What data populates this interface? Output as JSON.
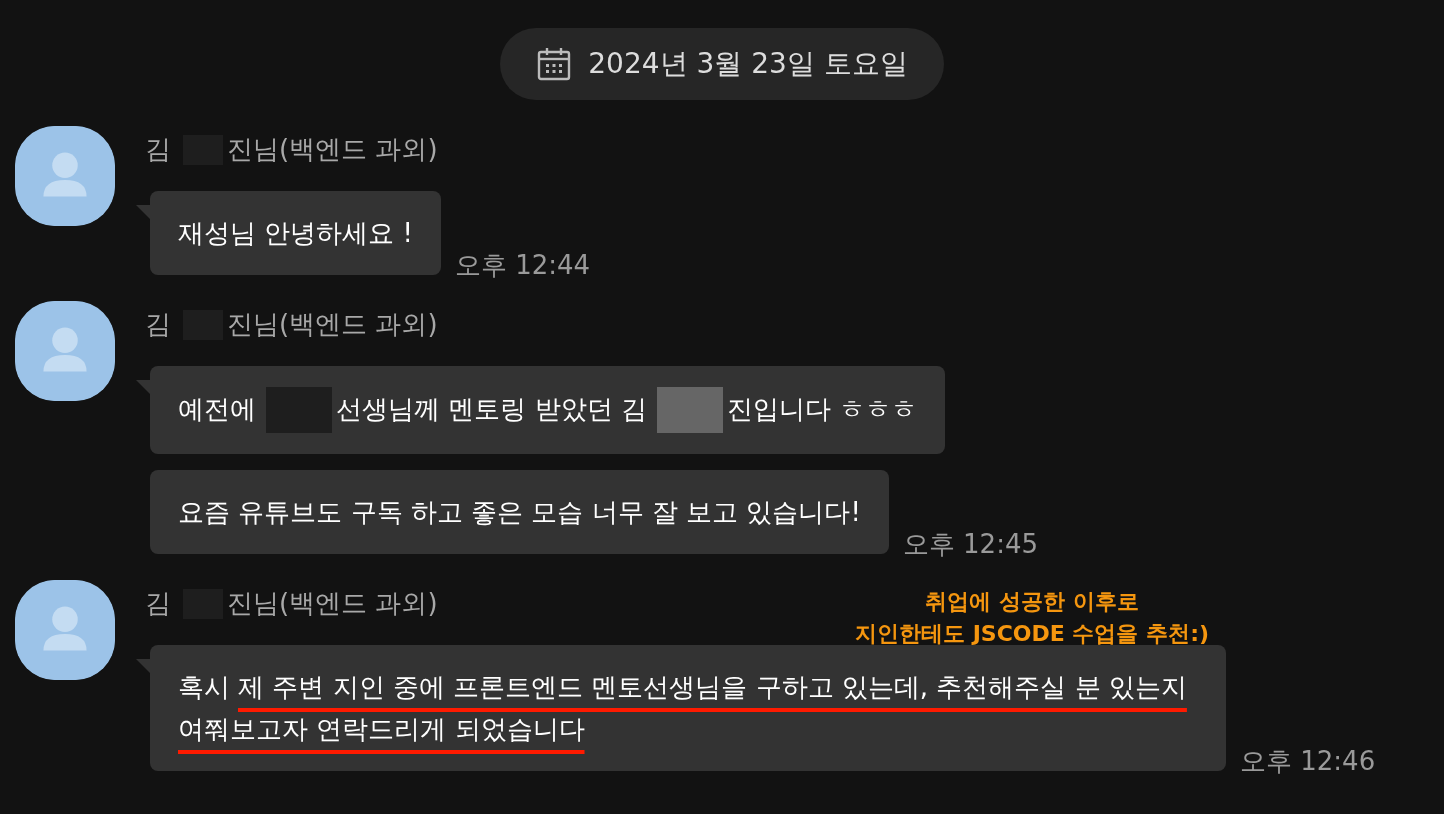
{
  "date_divider": {
    "text": "2024년 3월 23일 토요일"
  },
  "groups": [
    {
      "sender": [
        {
          "kind": "text",
          "text": "김"
        },
        {
          "kind": "redacted",
          "color": "#1e1e1e"
        },
        {
          "kind": "text",
          "text": "진님(백엔드 과외)"
        }
      ],
      "messages": [
        {
          "parts": [
            {
              "kind": "text",
              "text": "재성님 안녕하세요 !"
            }
          ]
        }
      ],
      "time": "오후 12:44"
    },
    {
      "sender": [
        {
          "kind": "text",
          "text": "김"
        },
        {
          "kind": "redacted",
          "color": "#1e1e1e"
        },
        {
          "kind": "text",
          "text": "진님(백엔드 과외)"
        }
      ],
      "messages": [
        {
          "parts": [
            {
              "kind": "text",
              "text": "예전에"
            },
            {
              "kind": "redacted",
              "color": "#1e1e1e"
            },
            {
              "kind": "text",
              "text": "선생님께 멘토링 받았던 김"
            },
            {
              "kind": "redacted",
              "color": "#666666"
            },
            {
              "kind": "text",
              "text": "진입니다 ㅎㅎㅎ"
            }
          ]
        },
        {
          "parts": [
            {
              "kind": "text",
              "text": "요즘 유튜브도 구독 하고 좋은 모습 너무 잘 보고 있습니다!"
            }
          ]
        }
      ],
      "time": "오후 12:45"
    },
    {
      "sender": [
        {
          "kind": "text",
          "text": "김"
        },
        {
          "kind": "redacted",
          "color": "#1e1e1e"
        },
        {
          "kind": "text",
          "text": "진님(백엔드 과외)"
        }
      ],
      "messages": [
        {
          "parts": [
            {
              "kind": "text",
              "text": "혹시"
            },
            {
              "kind": "underlined",
              "text": "제 주변 지인 중에 프론트엔드 멘토선생님을 구하고 있는데, 추천해주실 분 있는지 여쭤보고자 연락드리게 되었습니다"
            }
          ]
        }
      ],
      "time": "오후 12:46",
      "annotation": [
        "취업에 성공한 이후로",
        "지인한테도 JSCODE 수업을 추천:)"
      ]
    }
  ]
}
